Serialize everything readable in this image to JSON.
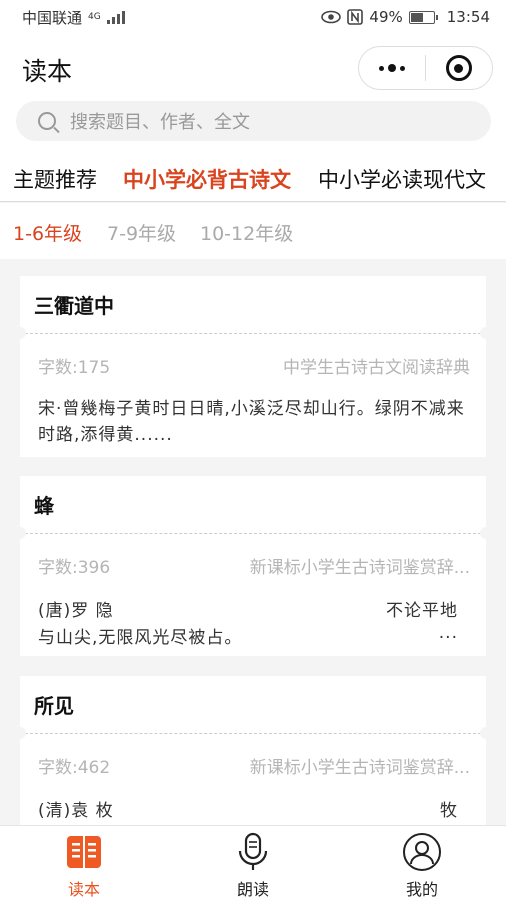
{
  "status_bar": {
    "carrier": "中国联通",
    "network": "4G",
    "battery": "49%",
    "time": "13:54"
  },
  "header": {
    "title": "读本",
    "more_icon": "more-dots-icon",
    "close_icon": "target-circle-icon"
  },
  "search": {
    "placeholder": "搜索题目、作者、全文"
  },
  "tabs": [
    {
      "label": "主题推荐",
      "active": false
    },
    {
      "label": "中小学必背古诗文",
      "active": true
    },
    {
      "label": "中小学必读现代文",
      "active": false
    }
  ],
  "grades": [
    {
      "label": "1-6年级",
      "active": true
    },
    {
      "label": "7-9年级",
      "active": false
    },
    {
      "label": "10-12年级",
      "active": false
    }
  ],
  "cards": [
    {
      "title": "三衢道中",
      "count": "字数:175",
      "source": "中学生古诗古文阅读辞典",
      "excerpt": "宋·曾幾梅子黄时日日晴,小溪泛尽却山行。绿阴不减来时路,添得黄......"
    },
    {
      "title": "蜂",
      "count": "字数:396",
      "source": "新课标小学生古诗词鉴赏辞...",
      "author": "(唐)罗 隐",
      "right_text": "不论平地",
      "line2": "与山尖,无限风光尽被占。",
      "ellipsis": "..."
    },
    {
      "title": "所见",
      "count": "字数:462",
      "source": "新课标小学生古诗词鉴赏辞...",
      "author": "(清)袁 枚",
      "right_text": "牧"
    }
  ],
  "bottom_nav": [
    {
      "label": "读本",
      "icon": "book-icon",
      "active": true
    },
    {
      "label": "朗读",
      "icon": "microphone-icon",
      "active": false
    },
    {
      "label": "我的",
      "icon": "user-icon",
      "active": false
    }
  ],
  "colors": {
    "accent": "#d9441f",
    "nav_active": "#e8541f",
    "muted": "#b5b5b5",
    "background": "#f4f4f4"
  }
}
